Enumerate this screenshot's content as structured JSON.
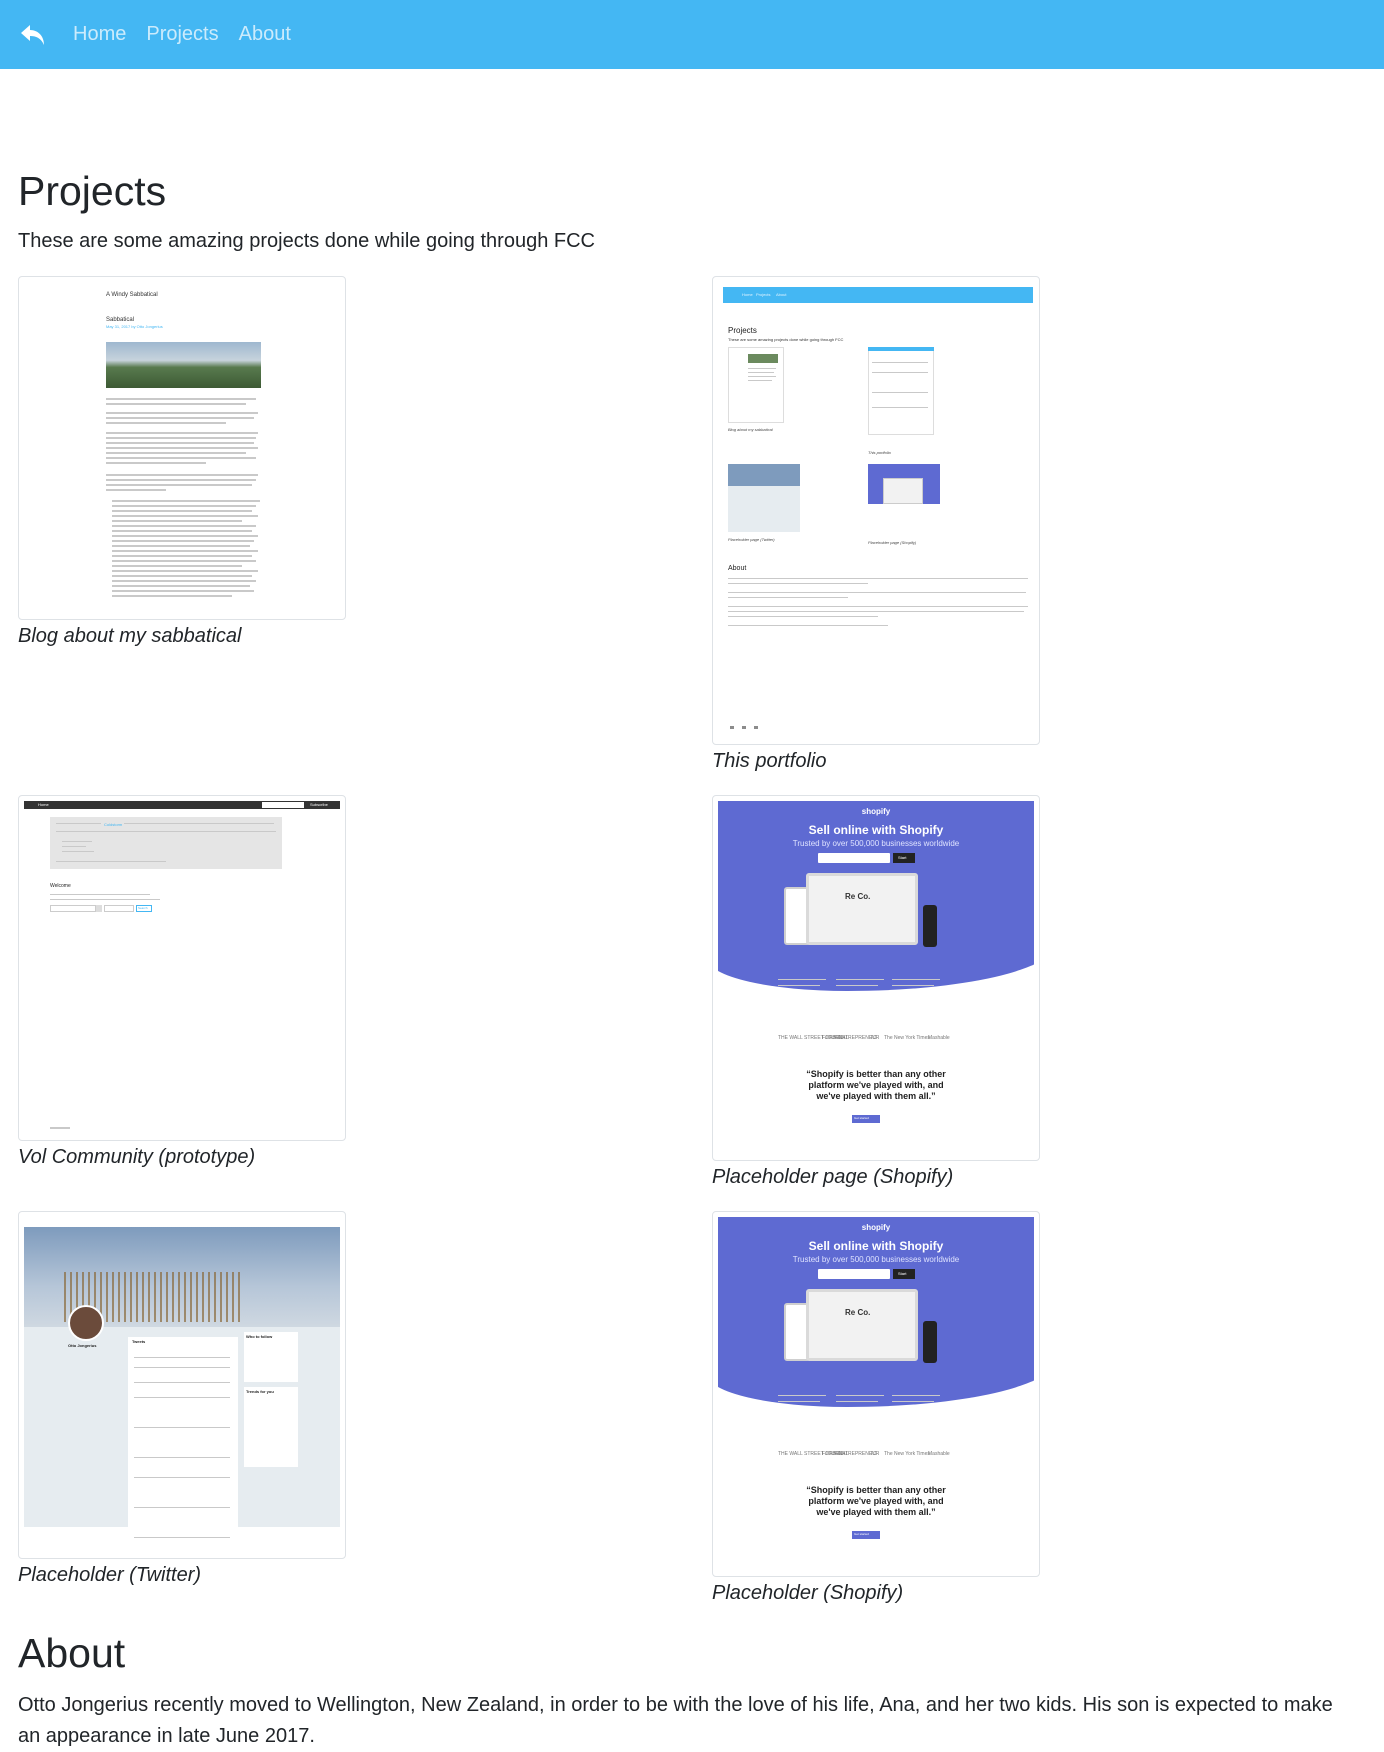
{
  "navbar": {
    "back_icon": "back-arrow-icon",
    "links": [
      "Home",
      "Projects",
      "About"
    ],
    "background": "#44b7f3"
  },
  "projects": {
    "title": "Projects",
    "lead": "These are some amazing projects done while going through FCC",
    "items": [
      {
        "caption": "Blog about my sabbatical"
      },
      {
        "caption": "This portfolio"
      },
      {
        "caption": "Vol Community (prototype)"
      },
      {
        "caption": "Placeholder page (Shopify)"
      },
      {
        "caption": "Placeholder (Twitter)"
      },
      {
        "caption": "Placeholder (Shopify)"
      }
    ]
  },
  "thumbs": {
    "blog": {
      "site": "A Windy Sabbatical",
      "post": "Sabbatical",
      "date": "May 31, 2017 by Otto Jongerius"
    },
    "portfolio": {
      "nav": [
        "Home",
        "Projects",
        "About"
      ],
      "title": "Projects",
      "lead": "These are some amazing projects done while going through FCC",
      "captions": [
        "Blog about my sabbatical",
        "This portfolio",
        "Placeholder page (Twitter)",
        "Placeholder page (Shopify)"
      ],
      "about_title": "About"
    },
    "vol": {
      "nav_home": "Home",
      "subscribe": "Subscribe",
      "alert_link": "Coldstorm",
      "section": "Welcome",
      "search_btn": "Search"
    },
    "shopify": {
      "logo": "shopify",
      "title": "Sell online with Shopify",
      "subtitle": "Trusted by over 500,000 businesses worldwide",
      "start": "Start",
      "laptop_brand": "Re Co.",
      "brands": [
        "THE WALL STREET JOURNAL",
        "FORBES",
        "ENTREPRENEUR",
        "TC",
        "The New York Times",
        "Mashable"
      ],
      "quote": "“Shopify is better than any other platform we've played with, and we've played with them all.”",
      "cta": "Get started"
    },
    "twitter": {
      "name": "Otto Jongerius",
      "tab": "Tweets",
      "follow": "Who to follow",
      "trends": "Trends for you"
    }
  },
  "about": {
    "title": "About",
    "text": "Otto Jongerius recently moved to Wellington, New Zealand, in order to be with the love of his life, Ana, and her two kids. His son is expected to make an appearance in late June 2017."
  }
}
